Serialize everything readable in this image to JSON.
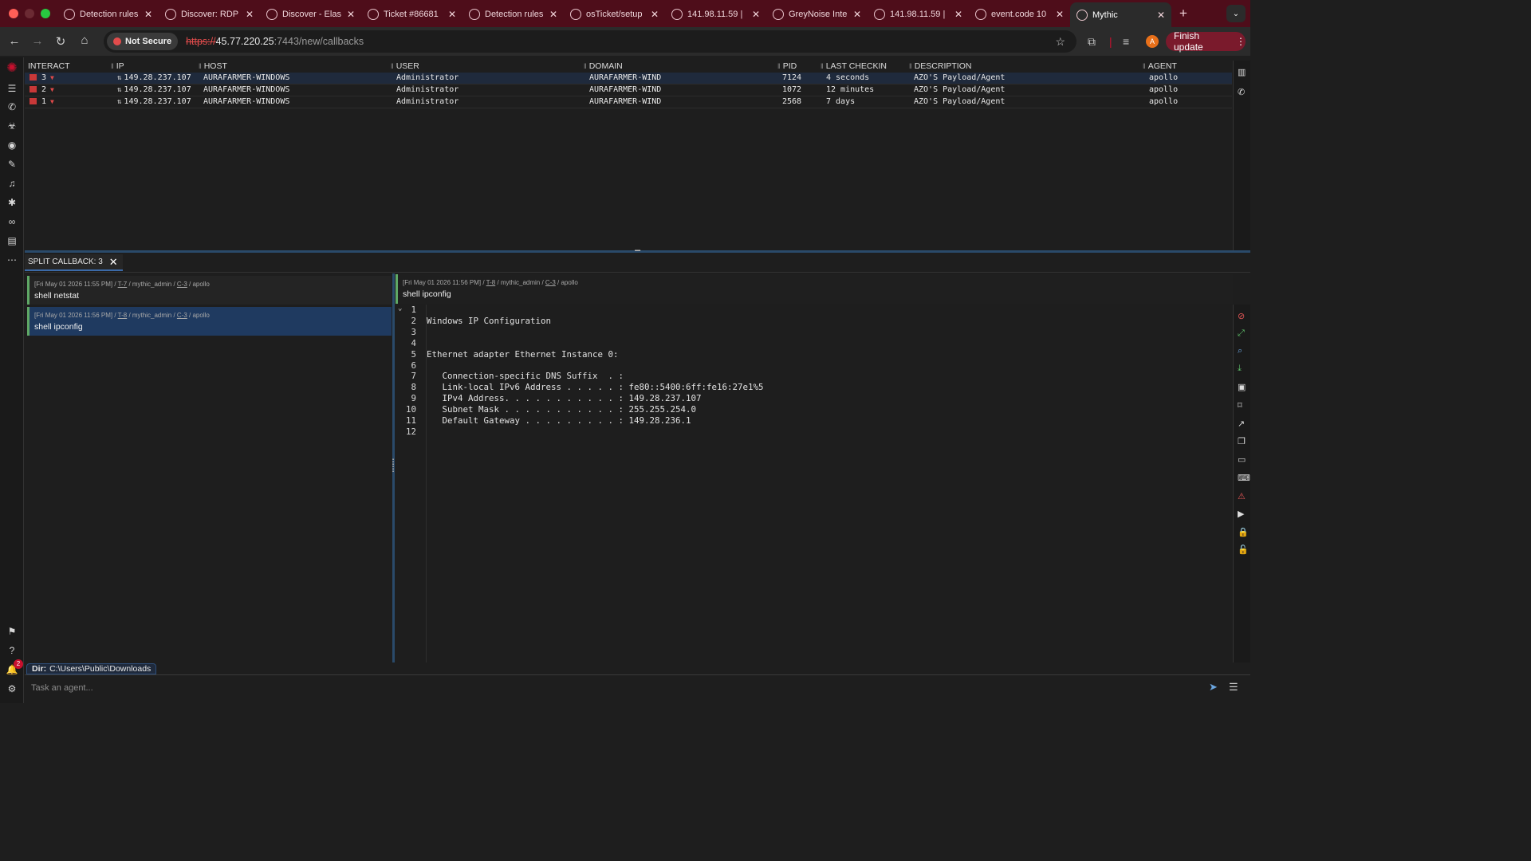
{
  "browser": {
    "tabs": [
      {
        "title": "Detection rules",
        "icon": "elastic-icon"
      },
      {
        "title": "Discover: RDP",
        "icon": "elastic-icon"
      },
      {
        "title": "Discover - Elas",
        "icon": "elastic-icon"
      },
      {
        "title": "Ticket #86681",
        "icon": "osticket-icon"
      },
      {
        "title": "Detection rules",
        "icon": "elastic-icon"
      },
      {
        "title": "osTicket/setup",
        "icon": "github-icon"
      },
      {
        "title": "141.98.11.59 |",
        "icon": "abuse-icon"
      },
      {
        "title": "GreyNoise Inte",
        "icon": "google-icon"
      },
      {
        "title": "141.98.11.59 |",
        "icon": "google-icon"
      },
      {
        "title": "event.code 10",
        "icon": "google-icon"
      },
      {
        "title": "Mythic",
        "icon": "mythic-icon"
      }
    ],
    "security_label": "Not Secure",
    "url_scheme": "https://",
    "url_host": "45.77.220.25",
    "url_path": ":7443/new/callbacks",
    "profile_initial": "A",
    "finish_update": "Finish update"
  },
  "callbacks": {
    "headers": {
      "interact": "INTERACT",
      "ip": "IP",
      "host": "HOST",
      "user": "USER",
      "domain": "DOMAIN",
      "pid": "PID",
      "last_checkin": "LAST CHECKIN",
      "description": "DESCRIPTION",
      "agent": "AGENT"
    },
    "rows": [
      {
        "id": "3",
        "ip": "149.28.237.107",
        "host": "AURAFARMER-WINDOWS",
        "user": "Administrator",
        "domain": "AURAFARMER-WIND",
        "pid": "7124",
        "last_checkin": "4 seconds",
        "description": "AZO'S Payload/Agent",
        "agent": "apollo"
      },
      {
        "id": "2",
        "ip": "149.28.237.107",
        "host": "AURAFARMER-WINDOWS",
        "user": "Administrator",
        "domain": "AURAFARMER-WIND",
        "pid": "1072",
        "last_checkin": "12 minutes",
        "description": "AZO'S Payload/Agent",
        "agent": "apollo"
      },
      {
        "id": "1",
        "ip": "149.28.237.107",
        "host": "AURAFARMER-WINDOWS",
        "user": "Administrator",
        "domain": "AURAFARMER-WIND",
        "pid": "2568",
        "last_checkin": "7 days",
        "description": "AZO'S Payload/Agent",
        "agent": "apollo"
      }
    ]
  },
  "split": {
    "tab_label": "SPLIT CALLBACK: 3"
  },
  "tasks": [
    {
      "timestamp": "[Fri May 01 2026 11:55 PM]",
      "task": "T-7",
      "operator": "mythic_admin",
      "callback": "C-3",
      "agent": "apollo",
      "command": "shell netstat"
    },
    {
      "timestamp": "[Fri May 01 2026 11:56 PM]",
      "task": "T-8",
      "operator": "mythic_admin",
      "callback": "C-3",
      "agent": "apollo",
      "command": "shell ipconfig"
    }
  ],
  "output": {
    "header": {
      "timestamp": "[Fri May 01 2026 11:56 PM]",
      "task": "T-8",
      "operator": "mythic_admin",
      "callback": "C-3",
      "agent": "apollo",
      "command": "shell ipconfig"
    },
    "lines": [
      "",
      "Windows IP Configuration",
      "",
      "",
      "Ethernet adapter Ethernet Instance 0:",
      "",
      "   Connection-specific DNS Suffix  . :",
      "   Link-local IPv6 Address . . . . . : fe80::5400:6ff:fe16:27e1%5",
      "   IPv4 Address. . . . . . . . . . . : 149.28.237.107",
      "   Subnet Mask . . . . . . . . . . . : 255.255.254.0",
      "   Default Gateway . . . . . . . . . : 149.28.236.1",
      ""
    ]
  },
  "footer": {
    "dir_label": "Dir:",
    "dir_value": "C:\\Users\\Public\\Downloads",
    "task_placeholder": "Task an agent...",
    "notification_count": "2"
  }
}
